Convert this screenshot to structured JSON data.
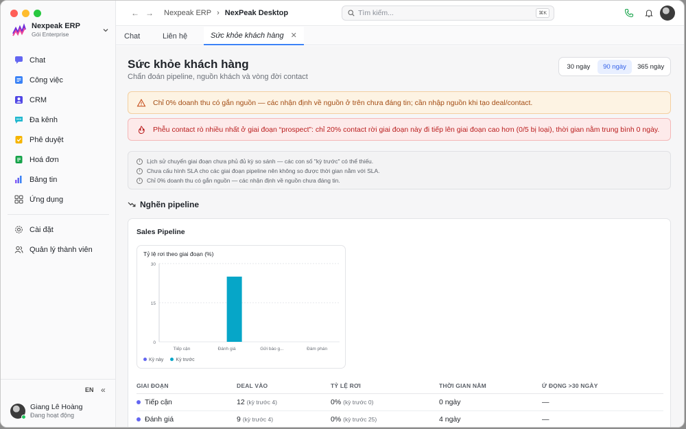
{
  "sidebar": {
    "brand": {
      "name": "Nexpeak ERP",
      "plan": "Gói Enterprise"
    },
    "items": [
      {
        "label": "Chat",
        "icon": "chat-icon"
      },
      {
        "label": "Công việc",
        "icon": "tasks-icon"
      },
      {
        "label": "CRM",
        "icon": "crm-icon"
      },
      {
        "label": "Đa kênh",
        "icon": "omnichannel-icon"
      },
      {
        "label": "Phê duyệt",
        "icon": "approval-icon"
      },
      {
        "label": "Hoá đơn",
        "icon": "invoice-icon"
      },
      {
        "label": "Bảng tin",
        "icon": "dashboard-icon"
      },
      {
        "label": "Ứng dụng",
        "icon": "apps-icon"
      }
    ],
    "settings": [
      {
        "label": "Cài đặt",
        "icon": "gear-icon"
      },
      {
        "label": "Quản lý thành viên",
        "icon": "members-icon"
      }
    ],
    "lang": "EN",
    "user": {
      "name": "Giang Lê Hoàng",
      "status": "Đang hoạt động"
    }
  },
  "topbar": {
    "crumbs": [
      "Nexpeak ERP",
      "NexPeak Desktop"
    ],
    "search_placeholder": "Tìm kiếm...",
    "shortcut": "⌘K"
  },
  "tabs": [
    {
      "label": "Chat"
    },
    {
      "label": "Liên hệ"
    },
    {
      "label": "Sức khỏe khách hàng",
      "active": true
    }
  ],
  "page": {
    "title": "Sức khỏe khách hàng",
    "subtitle": "Chẩn đoán pipeline, nguồn khách và vòng đời contact",
    "ranges": [
      "30 ngày",
      "90 ngày",
      "365 ngày"
    ],
    "selected_range": "90 ngày"
  },
  "alerts": {
    "warning": "Chỉ 0% doanh thu có gắn nguồn — các nhận định về nguồn ở trên chưa đáng tin; cần nhập nguồn khi tạo deal/contact.",
    "error": "Phễu contact rò nhiều nhất ở giai đoạn “prospect”: chỉ 20% contact rời giai đoạn này đi tiếp lên giai đoạn cao hơn (0/5 bị loại), thời gian nằm trung bình 0 ngày."
  },
  "notes": [
    "Lịch sử chuyển giai đoạn chưa phủ đủ kỳ so sánh — các con số \"kỳ trước\" có thể thiếu.",
    "Chưa cấu hình SLA cho các giai đoạn pipeline nên không so được thời gian nằm với SLA.",
    "Chỉ 0% doanh thu có gắn nguồn — các nhận định về nguồn chưa đáng tin."
  ],
  "section": {
    "title": "Nghẽn pipeline"
  },
  "pipeline": {
    "title": "Sales Pipeline",
    "table_headers": [
      "GIAI ĐOẠN",
      "DEAL VÀO",
      "TỶ LỆ RƠI",
      "THỜI GIAN NẰM",
      "Ứ ĐỌNG >30 NGÀY"
    ],
    "rows": [
      {
        "stage": "Tiếp cận",
        "deals": "12",
        "deals_prev": "(kỳ trước 4)",
        "drop": "0%",
        "drop_prev": "(kỳ trước 0)",
        "time": "0 ngày",
        "stuck": "—"
      },
      {
        "stage": "Đánh giá",
        "deals": "9",
        "deals_prev": "(kỳ trước 4)",
        "drop": "0%",
        "drop_prev": "(kỳ trước 25)",
        "time": "4 ngày",
        "stuck": "—"
      }
    ]
  },
  "chart_data": {
    "type": "bar",
    "title": "Tỷ lệ rơi theo giai đoạn (%)",
    "categories": [
      "Tiếp cận",
      "Đánh giá",
      "Gửi báo g...",
      "Đàm phán"
    ],
    "series": [
      {
        "name": "Kỳ này",
        "color": "#6366f1",
        "values": [
          0,
          0,
          0,
          0
        ]
      },
      {
        "name": "Kỳ trước",
        "color": "#06a6c8",
        "values": [
          0,
          25,
          0,
          0
        ]
      }
    ],
    "ylim": [
      0,
      30
    ],
    "yticks": [
      0,
      15,
      30
    ],
    "legend": "bottom-left"
  }
}
